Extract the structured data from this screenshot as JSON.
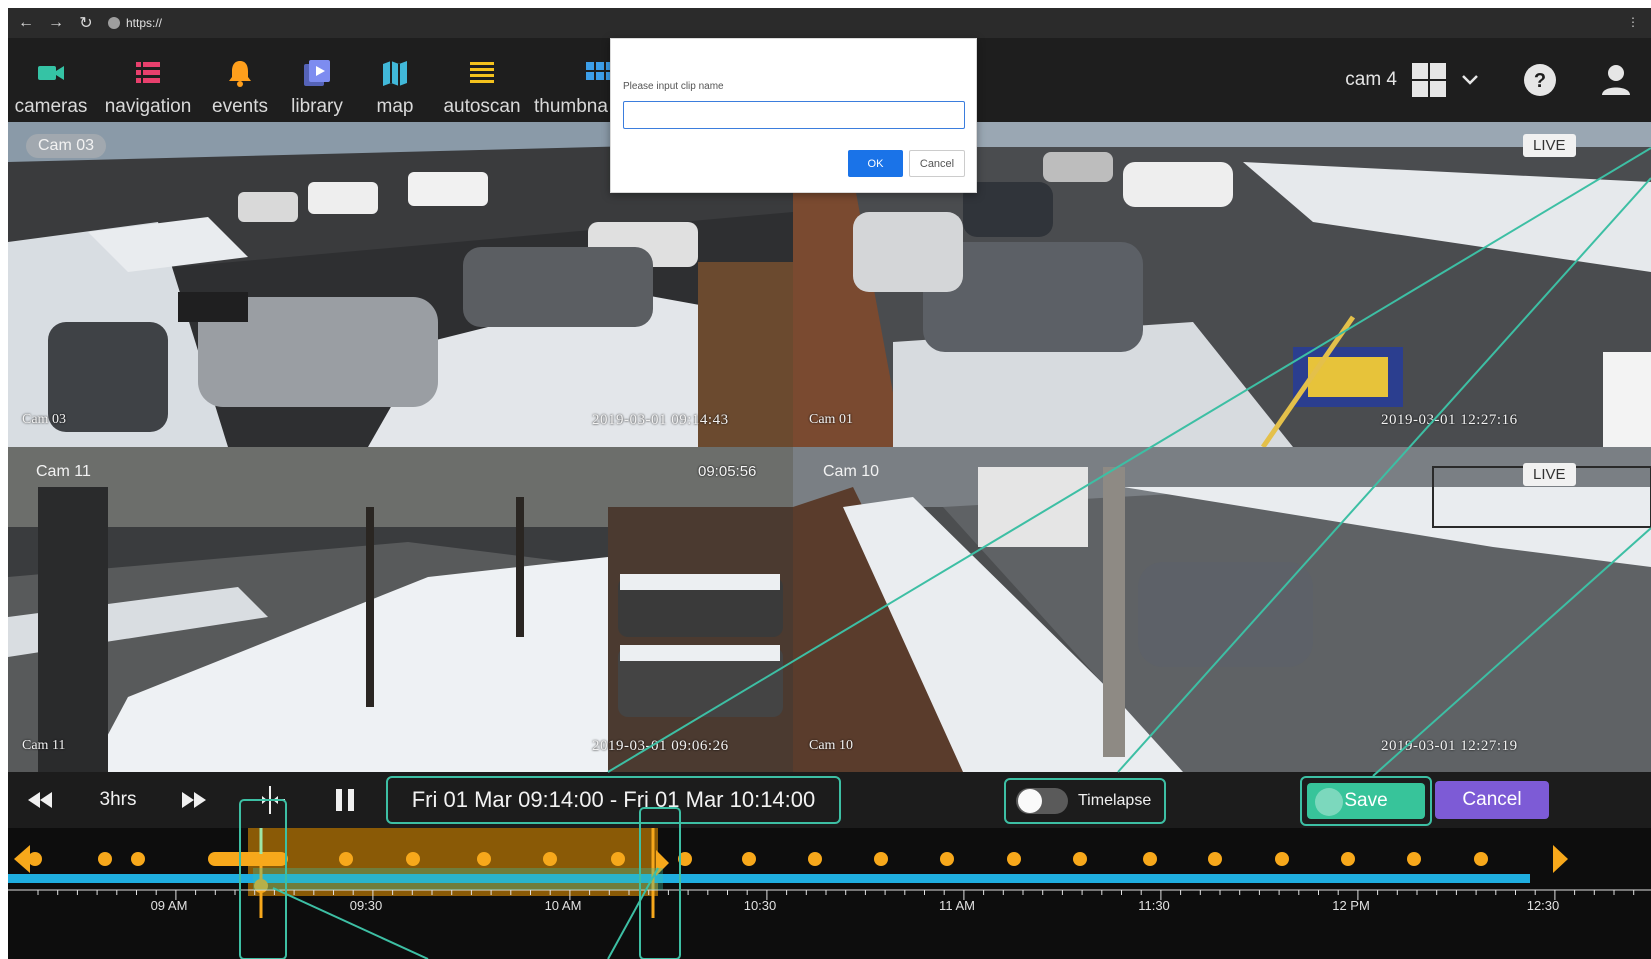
{
  "browser": {
    "url": "https://",
    "back_icon": "arrow-left-icon",
    "forward_icon": "arrow-right-icon",
    "reload_icon": "reload-icon"
  },
  "nav": {
    "items": [
      {
        "label": "cameras",
        "icon": "video-camera-icon",
        "color": "#35c3a5"
      },
      {
        "label": "navigation",
        "icon": "list-icon",
        "color": "#e8406d"
      },
      {
        "label": "events",
        "icon": "bell-icon",
        "color": "#ff9f1c"
      },
      {
        "label": "library",
        "icon": "library-play-icon",
        "color": "#7d8cf0"
      },
      {
        "label": "map",
        "icon": "map-icon",
        "color": "#41b8d9"
      },
      {
        "label": "autoscan",
        "icon": "lines-icon",
        "color": "#f4c21d"
      },
      {
        "label": "thumbna",
        "icon": "thumbnails-icon",
        "color": "#3c9ee8"
      }
    ],
    "cam_count": "cam 4"
  },
  "cameras": [
    {
      "pill_label": "Cam 03",
      "osd_label": "Cam 03",
      "timestamp": "2019-03-01 09:14:43",
      "selected": true
    },
    {
      "osd_label": "Cam 01",
      "timestamp": "2019-03-01 12:27:16",
      "badge": "LIVE"
    },
    {
      "pill_label": "Cam 11",
      "osd_label": "Cam 11",
      "clock": "09:05:56",
      "timestamp": "2019-03-01 09:06:26"
    },
    {
      "pill_label": "Cam 10",
      "osd_label": "Cam 10",
      "timestamp": "2019-03-01 12:27:19",
      "badge": "LIVE"
    }
  ],
  "dialog": {
    "label": "Please input clip name",
    "input_value": "",
    "ok_label": "OK",
    "cancel_label": "Cancel"
  },
  "controls": {
    "duration_label": "3hrs",
    "range_text": "Fri 01 Mar  09:14:00 - Fri 01 Mar  10:14:00",
    "timelapse_label": "Timelapse",
    "timelapse_on": false,
    "save_label": "Save",
    "cancel_label": "Cancel"
  },
  "timeline": {
    "tick_labels": [
      "09 AM",
      "09:30",
      "10 AM",
      "10:30",
      "11 AM",
      "11:30",
      "12 PM",
      "12:30"
    ],
    "colors": {
      "selection": "#8a5a06",
      "track": "#1faee0",
      "marker": "#f7a81b",
      "annotation": "#3dbfa4"
    }
  }
}
